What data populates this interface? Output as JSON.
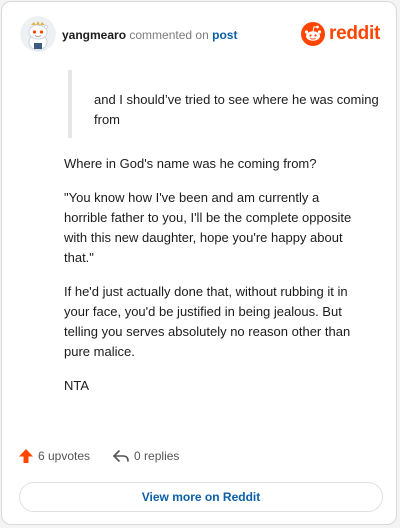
{
  "header": {
    "username": "yangmearo",
    "action": "commented on",
    "post_link": "post",
    "brand": "reddit"
  },
  "colors": {
    "brand": "#ff4500",
    "link": "#0a5fa8",
    "upvote": "#ff4500"
  },
  "icons": {
    "avatar": "snoo-avatar",
    "brand": "reddit-snoo-icon",
    "upvote": "upvote-arrow-icon",
    "reply": "reply-arrow-icon"
  },
  "comment": {
    "quote": "and I should’ve tried to see where he was coming from",
    "paragraphs": [
      "Where in God's name was he coming from?",
      "\"You know how I've been and am currently a horrible father to you, I'll be the complete opposite with this new daughter, hope you're happy about that.\"",
      "If he'd just actually done that, without rubbing it in your face, you'd be justified in being jealous. But telling you serves absolutely no reason other than pure malice.",
      "NTA"
    ]
  },
  "footer": {
    "upvotes": "6 upvotes",
    "replies": "0 replies",
    "view_more": "View more on Reddit"
  }
}
